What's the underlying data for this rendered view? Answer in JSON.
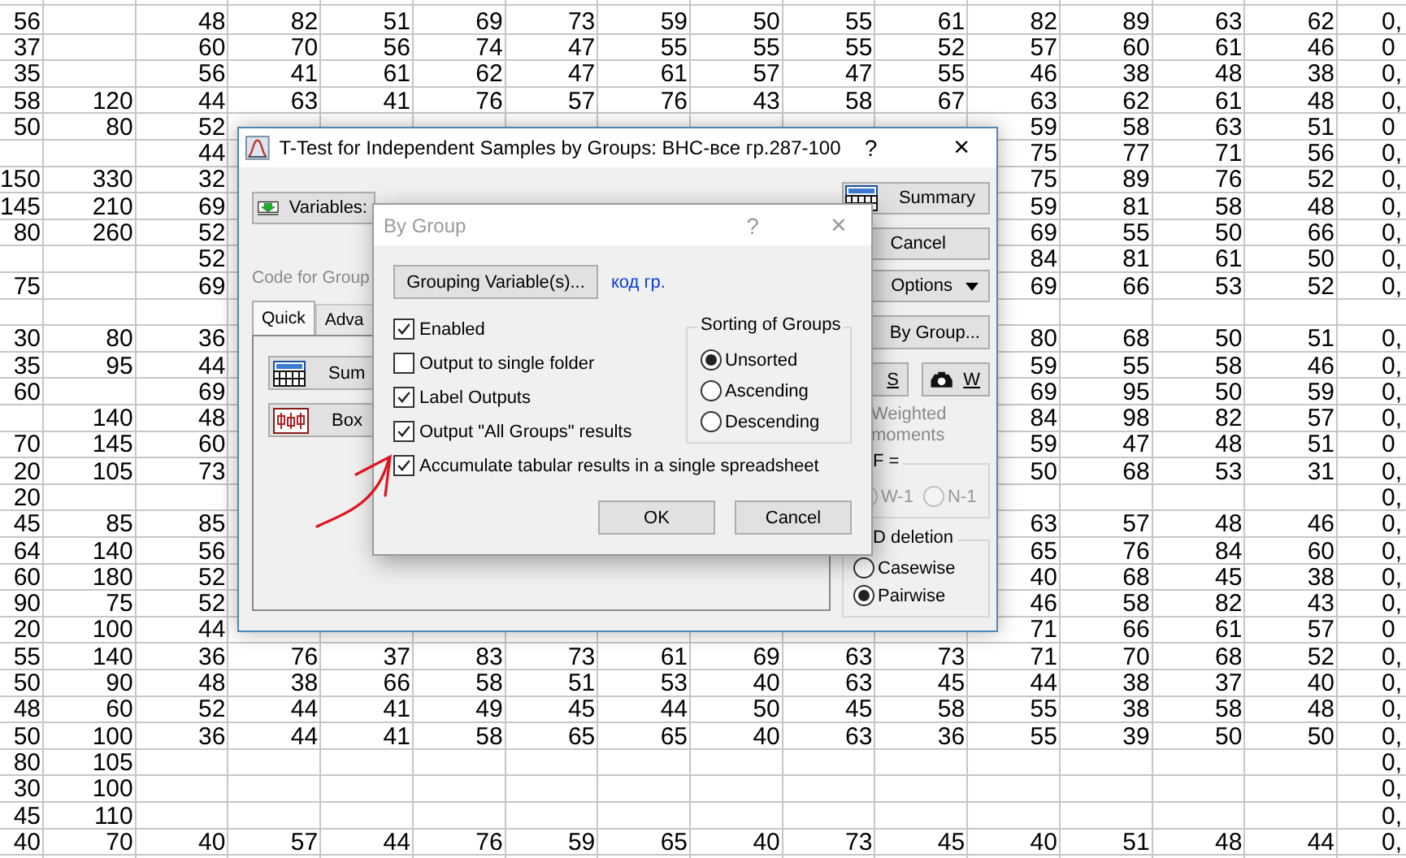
{
  "sheet": {
    "rows": [
      [
        "56",
        null,
        "48",
        "82",
        "51",
        "69",
        "73",
        "59",
        "50",
        "55",
        "61",
        "82",
        "89",
        "63",
        "62",
        "0,"
      ],
      [
        "37",
        null,
        "60",
        "70",
        "56",
        "74",
        "47",
        "55",
        "55",
        "55",
        "52",
        "57",
        "60",
        "61",
        "46",
        "0"
      ],
      [
        "35",
        null,
        "56",
        "41",
        "61",
        "62",
        "47",
        "61",
        "57",
        "47",
        "55",
        "46",
        "38",
        "48",
        "38",
        "0,"
      ],
      [
        "58",
        "120",
        "44",
        "63",
        "41",
        "76",
        "57",
        "76",
        "43",
        "58",
        "67",
        "63",
        "62",
        "61",
        "48",
        "0,"
      ],
      [
        "50",
        "80",
        "52",
        null,
        null,
        null,
        null,
        null,
        null,
        null,
        null,
        "59",
        "58",
        "63",
        "51",
        "0"
      ],
      [
        null,
        null,
        "44",
        null,
        null,
        null,
        null,
        null,
        null,
        null,
        null,
        "75",
        "77",
        "71",
        "56",
        "0,"
      ],
      [
        "150",
        "330",
        "32",
        null,
        null,
        null,
        null,
        null,
        null,
        null,
        null,
        "75",
        "89",
        "76",
        "52",
        "0,"
      ],
      [
        "145",
        "210",
        "69",
        null,
        null,
        null,
        null,
        null,
        null,
        null,
        null,
        "59",
        "81",
        "58",
        "48",
        "0,"
      ],
      [
        "80",
        "260",
        "52",
        null,
        null,
        null,
        null,
        null,
        null,
        null,
        null,
        "69",
        "55",
        "50",
        "66",
        "0,"
      ],
      [
        null,
        null,
        "52",
        null,
        null,
        null,
        null,
        null,
        null,
        null,
        null,
        "84",
        "81",
        "61",
        "50",
        "0,"
      ],
      [
        "75",
        null,
        "69",
        null,
        null,
        null,
        null,
        null,
        null,
        null,
        null,
        "69",
        "66",
        "53",
        "52",
        "0,"
      ],
      [
        null,
        null,
        null,
        null,
        null,
        null,
        null,
        null,
        null,
        null,
        null,
        null,
        null,
        null,
        null,
        null
      ],
      [
        "30",
        "80",
        "36",
        null,
        null,
        null,
        null,
        null,
        null,
        null,
        null,
        "80",
        "68",
        "50",
        "51",
        "0,"
      ],
      [
        "35",
        "95",
        "44",
        null,
        null,
        null,
        null,
        null,
        null,
        null,
        null,
        "59",
        "55",
        "58",
        "46",
        "0,"
      ],
      [
        "60",
        null,
        "69",
        null,
        null,
        null,
        null,
        null,
        null,
        null,
        null,
        "69",
        "95",
        "50",
        "59",
        "0,"
      ],
      [
        null,
        "140",
        "48",
        null,
        null,
        null,
        null,
        null,
        null,
        null,
        null,
        "84",
        "98",
        "82",
        "57",
        "0,"
      ],
      [
        "70",
        "145",
        "60",
        null,
        null,
        null,
        null,
        null,
        null,
        null,
        null,
        "59",
        "47",
        "48",
        "51",
        "0"
      ],
      [
        "20",
        "105",
        "73",
        null,
        null,
        null,
        null,
        null,
        null,
        null,
        null,
        "50",
        "68",
        "53",
        "31",
        "0,"
      ],
      [
        "20",
        null,
        null,
        null,
        null,
        null,
        null,
        null,
        null,
        null,
        null,
        null,
        null,
        null,
        null,
        "0,"
      ],
      [
        "45",
        "85",
        "85",
        null,
        null,
        null,
        null,
        null,
        null,
        null,
        null,
        "63",
        "57",
        "48",
        "46",
        "0,"
      ],
      [
        "64",
        "140",
        "56",
        null,
        null,
        null,
        null,
        null,
        null,
        null,
        null,
        "65",
        "76",
        "84",
        "60",
        "0,"
      ],
      [
        "60",
        "180",
        "52",
        null,
        null,
        null,
        null,
        null,
        null,
        null,
        null,
        "40",
        "68",
        "45",
        "38",
        "0,"
      ],
      [
        "90",
        "75",
        "52",
        null,
        null,
        null,
        null,
        null,
        null,
        null,
        null,
        "46",
        "58",
        "82",
        "43",
        "0,"
      ],
      [
        "20",
        "100",
        "44",
        null,
        null,
        null,
        null,
        null,
        null,
        null,
        null,
        "71",
        "66",
        "61",
        "57",
        "0"
      ],
      [
        "55",
        "140",
        "36",
        "76",
        "37",
        "83",
        "73",
        "61",
        "69",
        "63",
        "73",
        "71",
        "70",
        "68",
        "52",
        "0,"
      ],
      [
        "50",
        "90",
        "48",
        "38",
        "66",
        "58",
        "51",
        "53",
        "40",
        "63",
        "45",
        "44",
        "38",
        "37",
        "40",
        "0,"
      ],
      [
        "48",
        "60",
        "52",
        "44",
        "41",
        "49",
        "45",
        "44",
        "50",
        "45",
        "58",
        "55",
        "38",
        "58",
        "48",
        "0,"
      ],
      [
        "50",
        "100",
        "36",
        "44",
        "41",
        "58",
        "65",
        "65",
        "40",
        "63",
        "36",
        "55",
        "39",
        "50",
        "50",
        "0,"
      ],
      [
        "80",
        "105",
        null,
        null,
        null,
        null,
        null,
        null,
        null,
        null,
        null,
        null,
        null,
        null,
        null,
        "0,"
      ],
      [
        "30",
        "100",
        null,
        null,
        null,
        null,
        null,
        null,
        null,
        null,
        null,
        null,
        null,
        null,
        null,
        "0,"
      ],
      [
        "45",
        "110",
        null,
        null,
        null,
        null,
        null,
        null,
        null,
        null,
        null,
        null,
        null,
        null,
        null,
        "0,"
      ],
      [
        "40",
        "70",
        "40",
        "57",
        "44",
        "76",
        "59",
        "65",
        "40",
        "73",
        "45",
        "40",
        "51",
        "48",
        "44",
        "0,"
      ]
    ]
  },
  "ttest": {
    "title": "T-Test for Independent Samples by Groups: ВНС-все гр.287-100",
    "help": "?",
    "close": "×",
    "variables_button": "Variables:",
    "code_for_group": "Code for Group",
    "tabs": [
      {
        "label": "Quick",
        "selected": true
      },
      {
        "label": "Adva",
        "selected": false
      }
    ],
    "quick_buttons": [
      {
        "label": "Sum",
        "kind": "summary"
      },
      {
        "label": "Box",
        "kind": "boxplot"
      }
    ],
    "summary_button": "Summary",
    "cancel_button": "Cancel",
    "options_button": "Options",
    "by_group_button": "By Group...",
    "small_buttons": [
      {
        "label": "S",
        "kind": "plain"
      },
      {
        "label": "W",
        "kind": "printer"
      }
    ],
    "weighted_label": "Weighted moments",
    "df_group": {
      "legend": "F =",
      "options": [
        {
          "label": "W-1",
          "disabled": true
        },
        {
          "label": "N-1",
          "disabled": true
        }
      ]
    },
    "md_group": {
      "legend": "D deletion",
      "options": [
        {
          "label": "Casewise",
          "selected": false,
          "disabled": false
        },
        {
          "label": "Pairwise",
          "selected": true,
          "disabled": false
        }
      ]
    }
  },
  "by_group": {
    "title": "By Group",
    "help": "?",
    "close": "×",
    "grouping_button": "Grouping Variable(s)...",
    "grouping_value": "код гр.",
    "checkboxes": [
      {
        "label": "Enabled",
        "checked": true
      },
      {
        "label": "Output to single folder",
        "checked": false
      },
      {
        "label": "Label Outputs",
        "checked": true
      },
      {
        "label": "Output \"All Groups\" results",
        "checked": true
      },
      {
        "label": "Accumulate tabular results in a single spreadsheet",
        "checked": true
      }
    ],
    "sorting": {
      "legend": "Sorting of Groups",
      "options": [
        {
          "label": "Unsorted",
          "selected": true
        },
        {
          "label": "Ascending",
          "selected": false
        },
        {
          "label": "Descending",
          "selected": false
        }
      ]
    },
    "ok_button": "OK",
    "cancel_button": "Cancel"
  }
}
